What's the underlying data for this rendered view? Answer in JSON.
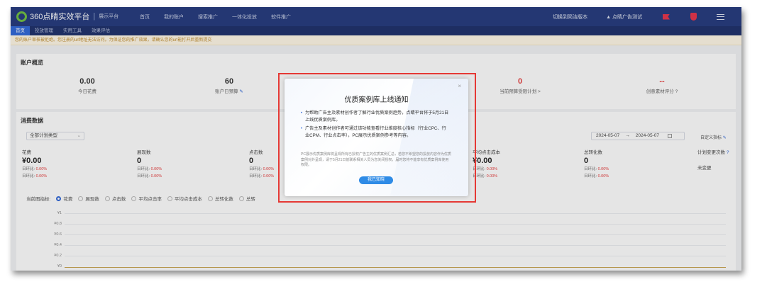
{
  "topbar": {
    "brand": "360点睛实效平台",
    "brand_sub": "展示平台",
    "nav": [
      "首页",
      "我的账户",
      "搜索推广",
      "一体化投放",
      "软件推广"
    ],
    "switch_label": "切换到简洁版本",
    "user_label": "点睛广告测试"
  },
  "subnav": [
    "首页",
    "投放管理",
    "实用工具",
    "效果评估"
  ],
  "notice": "您的账户审核被拒绝。您注册的url地址无法访问。为保证您的推广效果，请确认您的url能打开后重新提交",
  "overview": {
    "title": "账户概览",
    "items": [
      {
        "value": "0.00",
        "label": "今日花费"
      },
      {
        "value": "60",
        "label": "账户日预算"
      },
      {
        "value": "0",
        "label": "当前预算受限计划 >"
      },
      {
        "value": "--",
        "label": "创意素材评分"
      }
    ]
  },
  "consumption": {
    "title": "消费数据",
    "plan_type": "全部计划类型",
    "date_from": "2024-05-07",
    "date_sep": "→",
    "date_to": "2024-05-07",
    "custom_label": "自定义指标",
    "metrics": [
      {
        "label": "花费",
        "value": "¥0.00",
        "day": "日环比:",
        "day_v": "0.00%",
        "week": "日环比:",
        "week_v": "0.00%"
      },
      {
        "label": "展现数",
        "value": "0",
        "day": "日环比:",
        "day_v": "0.00%",
        "week": "日环比:",
        "week_v": "0.00%"
      },
      {
        "label": "点击数",
        "value": "0",
        "day": "日环比:",
        "day_v": "0.00%",
        "week": "日环比:",
        "week_v": "0.00%"
      },
      {
        "label": "平均点击成本",
        "value": "¥0.00",
        "day": "日环比:",
        "day_v": "0.00%",
        "week": "日环比:",
        "week_v": "0.00%"
      },
      {
        "label": "总转化数",
        "value": "0",
        "day": "日环比:",
        "day_v": "0.00%",
        "week": "日环比:",
        "week_v": "0.00%"
      }
    ],
    "plan_change_label": "计划变更次数",
    "plan_change_value": "未变更",
    "indicator_label": "当前图指标:",
    "radios": [
      "花费",
      "展现数",
      "点击数",
      "平均点击率",
      "平均点击成本",
      "总转化数",
      "总转"
    ],
    "yticks": [
      "¥1",
      "¥0.8",
      "¥0.6",
      "¥0.4",
      "¥0.2",
      "¥0"
    ]
  },
  "modal": {
    "title": "优质案例库上线通知",
    "bullet1": "为帮助广告主及素材创作者了解行业优质案例趋势，点睛平台将于5月21日上线优质案例库。",
    "bullet2": "广告主及素材创作者可通过该功能查看行业维度核心指标（行业CPC、行业CPM、行业点击率），PC展示优质案例参考等内容。",
    "note": "PC展示优质案例库将呈现所有已授权广告主的优质案例汇总，若您不希望您的投放内容作为优质案例对外呈现，请于5月21日前联系相关人员为您关闭授权，届时您将不能享有优质案例库使用权限。",
    "button": "我已知晓",
    "close": "×"
  }
}
